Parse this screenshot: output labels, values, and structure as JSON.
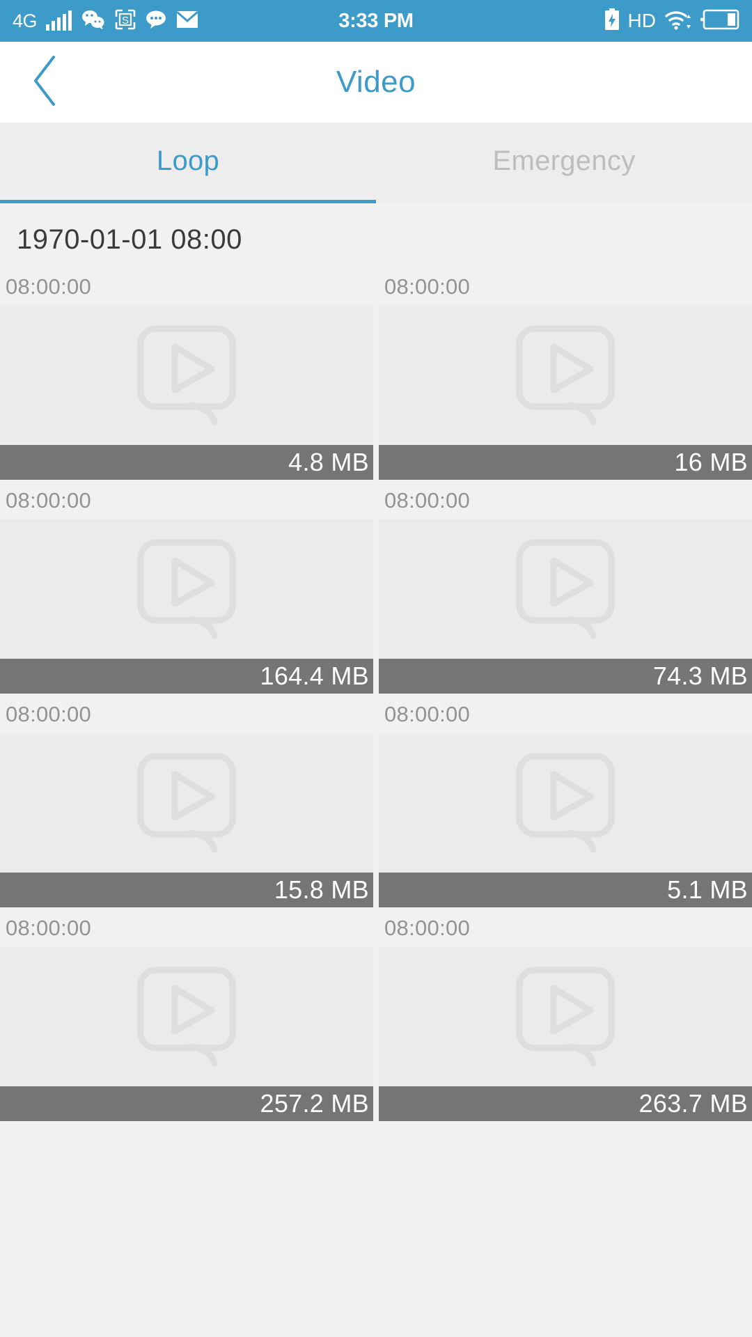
{
  "status_bar": {
    "network_label": "4G",
    "signal_icon": "signal-bars-icon",
    "wechat_icon": "wechat-icon",
    "screenshot_icon": "screenshot-s-icon",
    "message_icon": "message-bubble-icon",
    "mail_icon": "mail-icon",
    "time": "3:33 PM",
    "charging_icon": "battery-charging-icon",
    "hd_label": "HD",
    "wifi_icon": "wifi-icon",
    "battery_icon": "battery-icon",
    "background_color": "#3d9bc9",
    "foreground_color": "#ffffff"
  },
  "header": {
    "back_icon": "back-chevron-icon",
    "title": "Video",
    "accent_color": "#3d9bc9",
    "background_color": "#ffffff"
  },
  "tabs": {
    "items": [
      {
        "label": "Loop",
        "active": true
      },
      {
        "label": "Emergency",
        "active": false
      }
    ],
    "active_color": "#3d9bc9",
    "inactive_color": "#bdbdbd",
    "background_color": "#ededed"
  },
  "content": {
    "date_header": "1970-01-01 08:00",
    "placeholder_icon": "video-play-placeholder-icon",
    "size_bar_color": "#757575",
    "videos": [
      {
        "time": "08:00:00",
        "size": "4.8 MB"
      },
      {
        "time": "08:00:00",
        "size": "16 MB"
      },
      {
        "time": "08:00:00",
        "size": "164.4 MB"
      },
      {
        "time": "08:00:00",
        "size": "74.3 MB"
      },
      {
        "time": "08:00:00",
        "size": "15.8 MB"
      },
      {
        "time": "08:00:00",
        "size": "5.1 MB"
      },
      {
        "time": "08:00:00",
        "size": "257.2 MB"
      },
      {
        "time": "08:00:00",
        "size": "263.7 MB"
      }
    ]
  }
}
